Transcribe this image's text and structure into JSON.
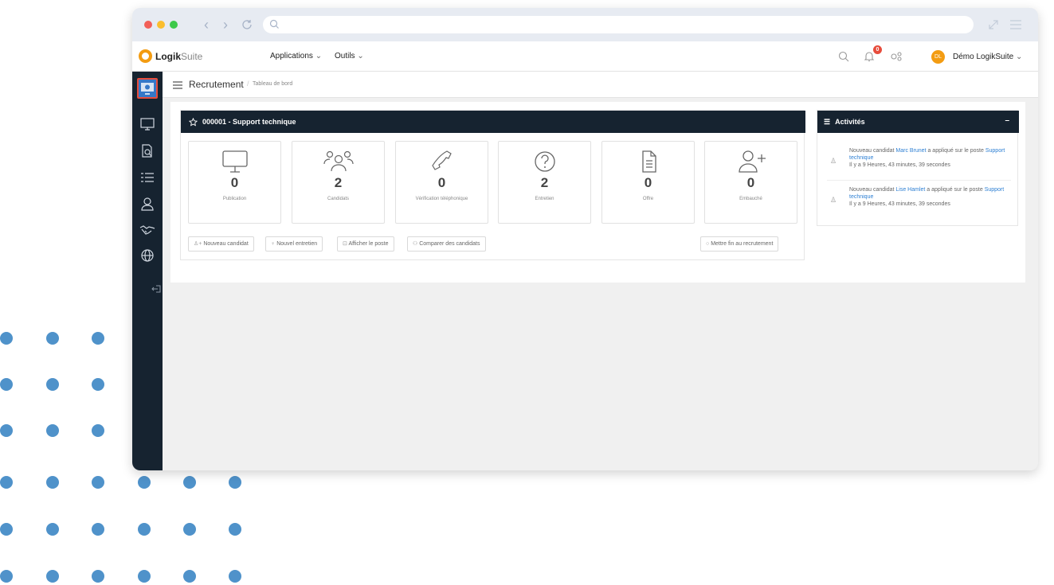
{
  "browser": {
    "address": ""
  },
  "app": {
    "logo_bold": "Logik",
    "logo_light": "Suite",
    "menu": [
      {
        "label": "Applications"
      },
      {
        "label": "Outils"
      }
    ],
    "notification_count": "0",
    "user": {
      "initials": "DL",
      "name": "Démo LogikSuite"
    }
  },
  "sidebar": {
    "items": [
      {
        "icon": "dashboard-icon"
      },
      {
        "icon": "monitor-icon"
      },
      {
        "icon": "document-search-icon"
      },
      {
        "icon": "list-icon"
      },
      {
        "icon": "user-icon"
      },
      {
        "icon": "handshake-icon"
      },
      {
        "icon": "globe-icon"
      },
      {
        "icon": "collapse-icon"
      }
    ]
  },
  "breadcrumb": {
    "title": "Recrutement",
    "separator": "/",
    "current": "Tableau de bord"
  },
  "job": {
    "title": "000001 - Support technique",
    "stages": [
      {
        "icon": "monitor-icon",
        "count": "0",
        "label": "Publication"
      },
      {
        "icon": "users-icon",
        "count": "2",
        "label": "Candidats"
      },
      {
        "icon": "phone-icon",
        "count": "0",
        "label": "Vérification téléphonique"
      },
      {
        "icon": "question-icon",
        "count": "2",
        "label": "Entretien"
      },
      {
        "icon": "document-icon",
        "count": "0",
        "label": "Offre"
      },
      {
        "icon": "user-plus-icon",
        "count": "0",
        "label": "Embauché"
      }
    ],
    "actions": [
      {
        "label": "Nouveau candidat",
        "icon": "user-plus-icon"
      },
      {
        "label": "Nouvel entretien",
        "icon": "bulb-icon"
      },
      {
        "label": "Afficher le poste",
        "icon": "briefcase-icon"
      },
      {
        "label": "Comparer des candidats",
        "icon": "compare-icon"
      }
    ],
    "end_action": {
      "label": "Mettre fin au recrutement",
      "icon": "circle-icon"
    }
  },
  "activities": {
    "title": "Activités",
    "collapse": "–",
    "items": [
      {
        "prefix": "Nouveau candidat ",
        "name": "Marc Brunet",
        "middle": " a appliqué sur le poste ",
        "job": "Support technique",
        "time": "Il y a 9 Heures, 43 minutes, 39 secondes"
      },
      {
        "prefix": "Nouveau candidat ",
        "name": "Lise Hamlet",
        "middle": " a appliqué sur le poste ",
        "job": "Support technique",
        "time": "Il y a 9 Heures, 43 minutes, 39 secondes"
      }
    ]
  },
  "colors": {
    "dark": "#162330",
    "accent": "#f39c12",
    "link": "#2d7fd3",
    "badge": "#e74c3c",
    "dots": "#4f92ca"
  }
}
